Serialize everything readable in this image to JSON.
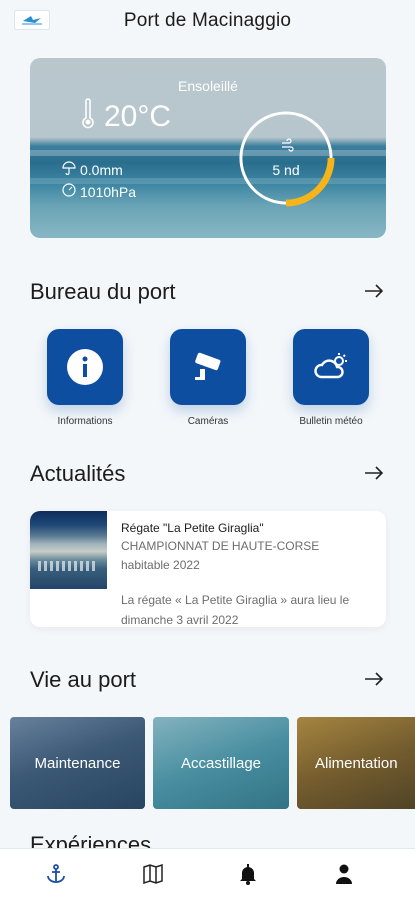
{
  "app": {
    "title": "Port de Macinaggio"
  },
  "weather": {
    "condition": "Ensoleillé",
    "temperature": "20°C",
    "rain": "0.0mm",
    "pressure": "1010hPa",
    "wind_speed": "5 nd",
    "wind_gauge_fraction": 0.25,
    "accent": "#f4b41a"
  },
  "bureau": {
    "title": "Bureau du port",
    "items": [
      {
        "label": "Informations",
        "icon": "info-icon"
      },
      {
        "label": "Caméras",
        "icon": "camera-icon"
      },
      {
        "label": "Bulletin météo",
        "icon": "weather-cloud-icon"
      }
    ]
  },
  "actualites": {
    "title": "Actualités",
    "items": [
      {
        "title": "Régate \"La Petite Giraglia\"",
        "subtitle_1": "CHAMPIONNAT DE HAUTE-CORSE",
        "subtitle_2": "habitable 2022",
        "description": "La régate « La Petite Giraglia » aura lieu le dimanche 3 avril 2022"
      }
    ]
  },
  "vie": {
    "title": "Vie au port",
    "items": [
      {
        "label": "Maintenance"
      },
      {
        "label": "Accastillage"
      },
      {
        "label": "Alimentation"
      }
    ]
  },
  "experiences": {
    "title": "Expériences"
  },
  "navbar": {
    "items": [
      "anchor-icon",
      "map-icon",
      "bell-icon",
      "user-icon"
    ],
    "active_color": "#1b4fa3"
  },
  "colors": {
    "brand": "#0d4ea0",
    "background": "#f3f7fa"
  }
}
